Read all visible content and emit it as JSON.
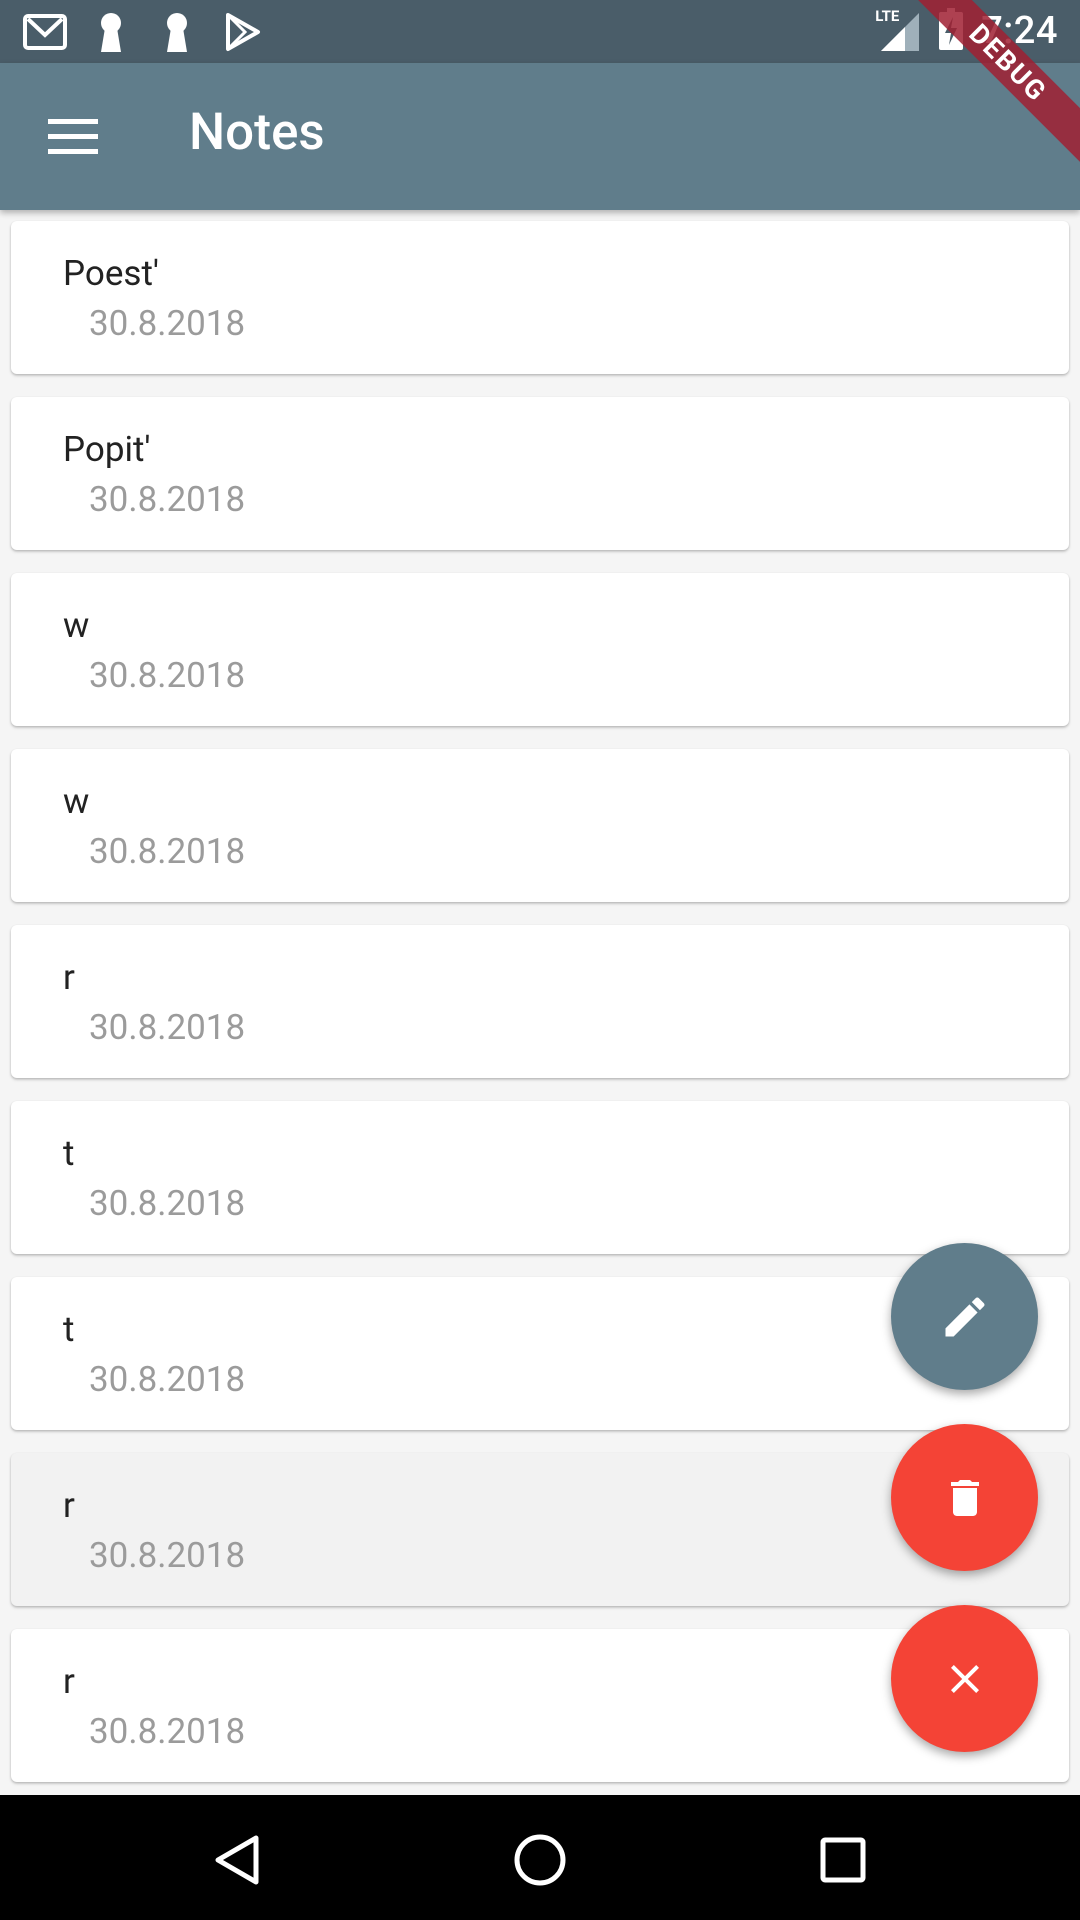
{
  "status_bar": {
    "time": "7:24",
    "network": "LTE",
    "left_icons": [
      "gmail-icon",
      "keyhole-icon",
      "keyhole-icon",
      "play-store-icon"
    ]
  },
  "debug_banner": "DEBUG",
  "app_bar": {
    "title": "Notes",
    "menu_icon": "menu-icon"
  },
  "notes": [
    {
      "title": "Poest'",
      "date": "30.8.2018"
    },
    {
      "title": "Popit'",
      "date": "30.8.2018"
    },
    {
      "title": "w",
      "date": "30.8.2018"
    },
    {
      "title": "w",
      "date": "30.8.2018"
    },
    {
      "title": "r",
      "date": "30.8.2018"
    },
    {
      "title": "t",
      "date": "30.8.2018"
    },
    {
      "title": "t",
      "date": "30.8.2018"
    },
    {
      "title": "r",
      "date": "30.8.2018",
      "selected": true
    },
    {
      "title": "r",
      "date": "30.8.2018"
    }
  ],
  "fabs": {
    "edit_icon": "pencil-icon",
    "delete_icon": "trash-icon",
    "close_icon": "close-icon"
  },
  "colors": {
    "app_bar": "#607d8b",
    "status_bar": "#4a5d69",
    "fab_edit": "#607d8b",
    "fab_delete": "#f44336",
    "fab_close": "#f44336"
  },
  "nav_bar": {
    "icons": [
      "back-icon",
      "home-icon",
      "recents-icon"
    ]
  }
}
